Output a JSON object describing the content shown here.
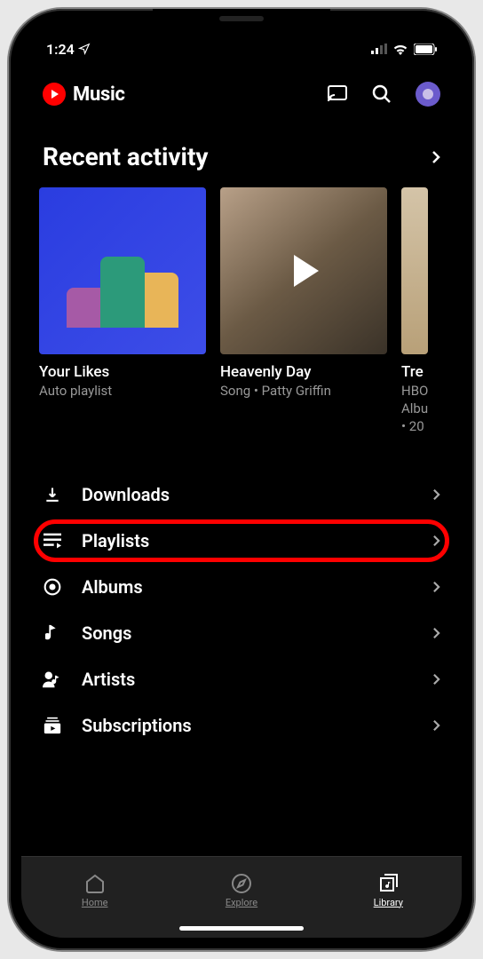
{
  "status": {
    "time": "1:24"
  },
  "header": {
    "app_name": "Music"
  },
  "recent": {
    "title": "Recent activity",
    "items": [
      {
        "title": "Your Likes",
        "subtitle": "Auto playlist"
      },
      {
        "title": "Heavenly Day",
        "subtitle": "Song • Patty Griffin"
      },
      {
        "title": "Tre",
        "subtitle": "HBO",
        "line3": "Albu",
        "line4": "• 20"
      }
    ]
  },
  "library": {
    "items": [
      {
        "label": "Downloads"
      },
      {
        "label": "Playlists",
        "highlighted": true
      },
      {
        "label": "Albums"
      },
      {
        "label": "Songs"
      },
      {
        "label": "Artists"
      },
      {
        "label": "Subscriptions"
      }
    ]
  },
  "tabs": [
    {
      "label": "Home"
    },
    {
      "label": "Explore"
    },
    {
      "label": "Library",
      "active": true
    }
  ]
}
